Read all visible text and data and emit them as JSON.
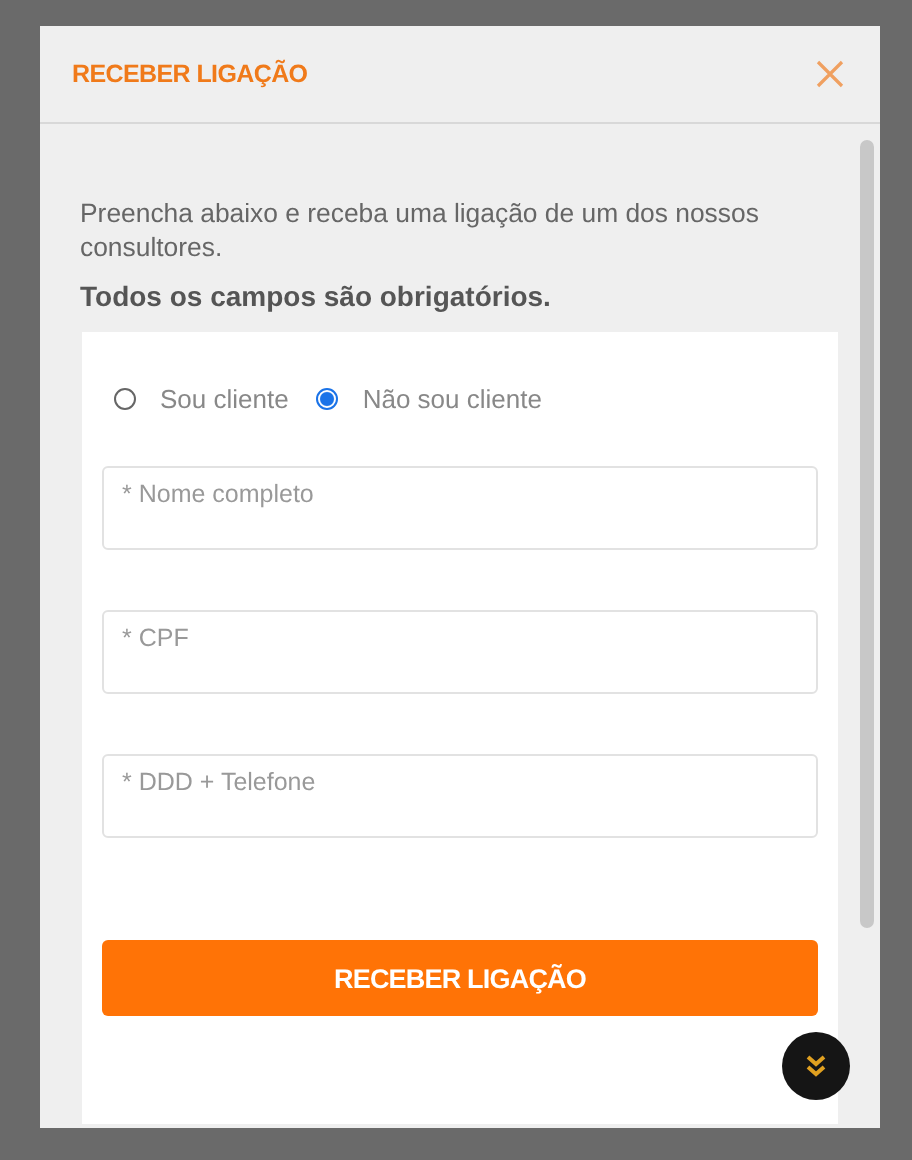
{
  "dialog": {
    "title": "RECEBER LIGAÇÃO"
  },
  "intro": "Preencha abaixo e receba uma ligação de um dos nossos consultores.",
  "notice": "Todos os campos são obrigatórios.",
  "radios": [
    {
      "label": "Sou cliente",
      "selected": false
    },
    {
      "label": "Não sou cliente",
      "selected": true
    }
  ],
  "fields": [
    {
      "placeholder": "* Nome completo"
    },
    {
      "placeholder": "* CPF"
    },
    {
      "placeholder": "* DDD + Telefone"
    }
  ],
  "submit": "RECEBER LIGAÇÃO"
}
